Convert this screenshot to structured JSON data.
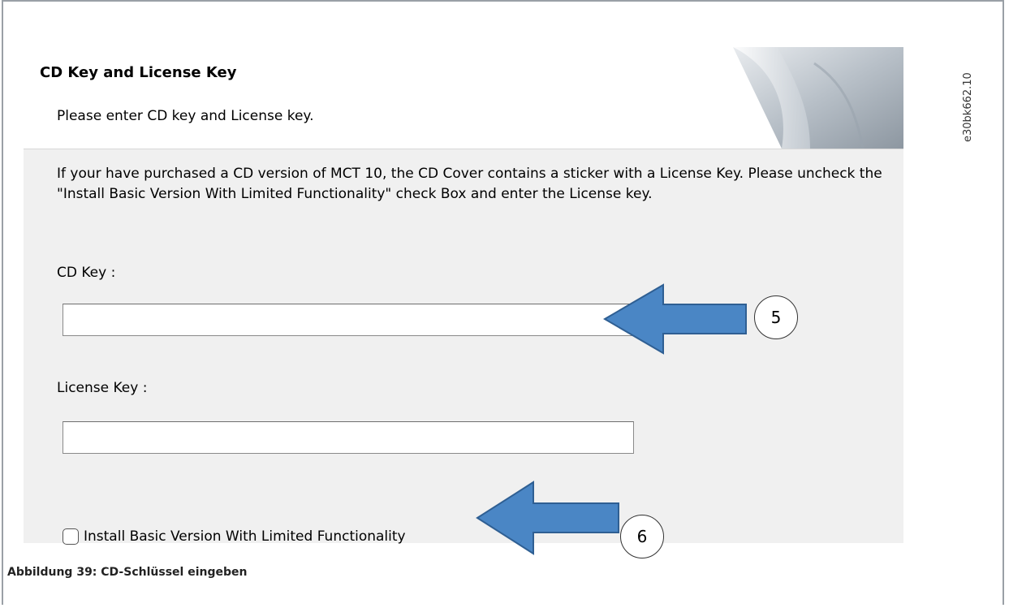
{
  "dialog": {
    "header": {
      "title": "CD Key and License Key",
      "subtitle": "Please enter CD key and License key."
    },
    "description": "If your have purchased a CD version of MCT 10, the CD Cover contains a sticker with a License Key. Please uncheck the \"Install Basic Version With Limited Functionality\" check Box and enter the License key.",
    "cd_key": {
      "label": "CD Key :",
      "value": ""
    },
    "license_key": {
      "label": "License Key :",
      "value": ""
    },
    "basic_version_checkbox": {
      "label": "Install Basic Version With Limited Functionality",
      "checked": false
    }
  },
  "callouts": [
    {
      "number": "5",
      "points_to": "cd_key"
    },
    {
      "number": "6",
      "points_to": "basic_version_checkbox"
    }
  ],
  "caption": "Abbildung 39: CD-Schlüssel eingeben",
  "figure_code": "e30bk662.10",
  "colors": {
    "arrow_fill": "#4a86c5",
    "arrow_stroke": "#2f5f93",
    "dialog_background": "#f0f0f0"
  }
}
